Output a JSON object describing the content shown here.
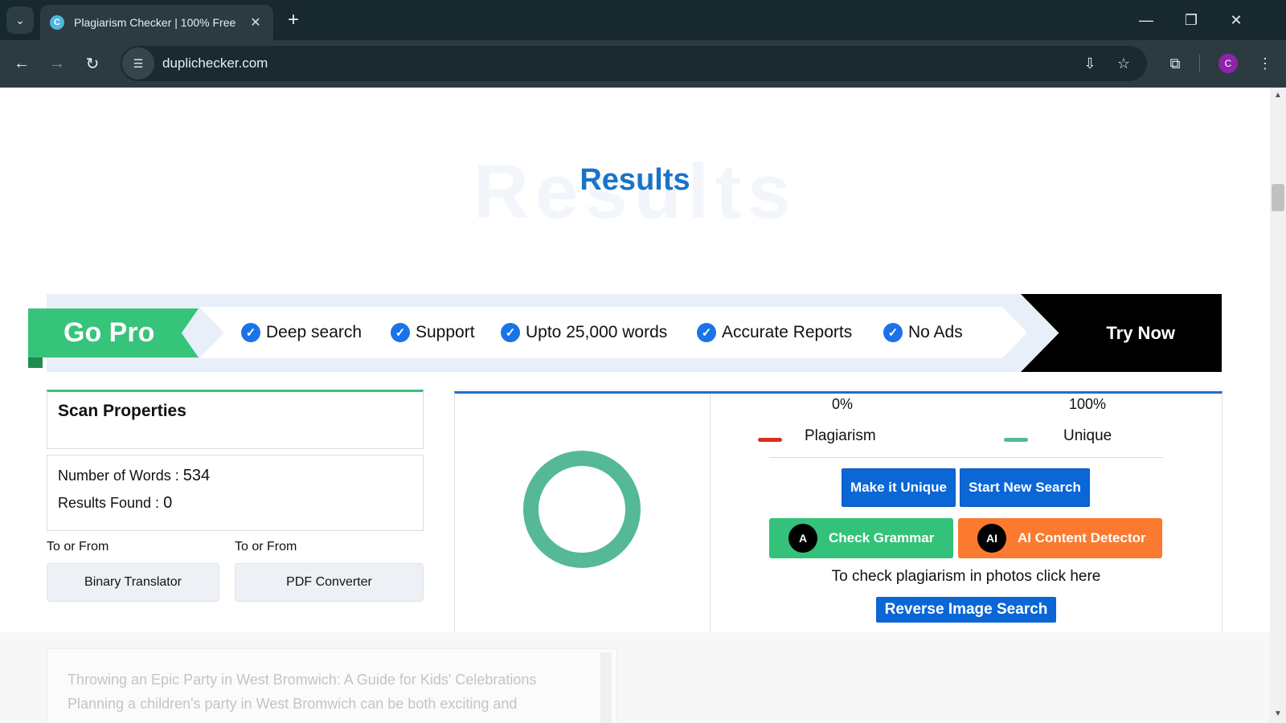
{
  "browser": {
    "tab_title": "Plagiarism Checker | 100% Free",
    "url": "duplichecker.com",
    "avatar_letter": "C",
    "favicon_letter": "C"
  },
  "page": {
    "results_bg_text": "Results",
    "results_title": "Results",
    "banner": {
      "gopro_label": "Go Pro",
      "features": [
        "Deep search",
        "Support",
        "Upto 25,000 words",
        "Accurate Reports",
        "No Ads"
      ],
      "try_now_label": "Try Now"
    },
    "scan": {
      "heading": "Scan Properties",
      "words_label": "Number of Words :",
      "words_value": "534",
      "results_label": "Results Found :",
      "results_value": "0",
      "to_or_from_1": "To or From",
      "to_or_from_2": "To or From",
      "link1_label": "Binary Translator",
      "link2_label": "PDF Converter"
    },
    "result_panel": {
      "plagiarism_pct": "0%",
      "unique_pct": "100%",
      "plagiarism_label": "Plagiarism",
      "unique_label": "Unique",
      "plagiarism_color": "#d93025",
      "unique_color": "#55b995",
      "make_unique_label": "Make it Unique",
      "start_new_label": "Start New Search",
      "grammar_label": "Check Grammar",
      "grammar_icon_text": "A",
      "ai_label": "AI Content Detector",
      "ai_icon_text": "AI",
      "photo_text": "To check plagiarism in photos click here",
      "reverse_label": "Reverse Image Search"
    },
    "textbox": {
      "line1": "Throwing an Epic Party in West Bromwich: A Guide for Kids' Celebrations",
      "line2": "Planning a children's party in West Bromwich can be both exciting and"
    }
  }
}
